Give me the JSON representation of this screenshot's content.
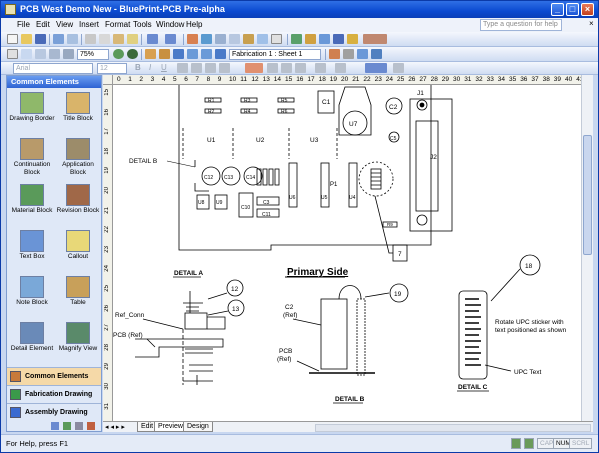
{
  "window": {
    "title": "PCB West Demo New - BluePrint-PCB Pre-alpha",
    "help_placeholder": "Type a question for help",
    "controls": {
      "minimize": "_",
      "maximize": "□",
      "close": "×"
    }
  },
  "menu": [
    "File",
    "Edit",
    "View",
    "Insert",
    "Format",
    "Tools",
    "Window",
    "Help"
  ],
  "toolbar2": {
    "zoom": "75%",
    "sheet": "Fabrication 1 : Sheet 1"
  },
  "toolbar3": {
    "font": "Arial",
    "size": "12",
    "bold": "B",
    "italic": "I",
    "underline": "U"
  },
  "panel": {
    "title": "Common Elements",
    "tiles": [
      {
        "label": "Drawing Border",
        "icon": "drawing-border-icon",
        "color": "#8fb86a"
      },
      {
        "label": "Title Block",
        "icon": "title-block-icon",
        "color": "#d9b46a"
      },
      {
        "label": "Continuation Block",
        "icon": "continuation-block-icon",
        "color": "#b89a6a"
      },
      {
        "label": "Application Block",
        "icon": "application-block-icon",
        "color": "#9c8c6a"
      },
      {
        "label": "Material Block",
        "icon": "material-block-icon",
        "color": "#5a9a5a"
      },
      {
        "label": "Revision Block",
        "icon": "revision-block-icon",
        "color": "#a06848"
      },
      {
        "label": "Text Box",
        "icon": "text-box-icon",
        "color": "#6a94d6"
      },
      {
        "label": "Callout",
        "icon": "callout-icon",
        "color": "#e8d878"
      },
      {
        "label": "Note Block",
        "icon": "note-block-icon",
        "color": "#7aa8d8"
      },
      {
        "label": "Table",
        "icon": "table-icon",
        "color": "#c8a05a"
      },
      {
        "label": "Detail Element",
        "icon": "detail-element-icon",
        "color": "#6a8ab8"
      },
      {
        "label": "Magnify View",
        "icon": "magnify-view-icon",
        "color": "#5a8a6a"
      }
    ],
    "categories": [
      {
        "label": "Common Elements",
        "icon": "common-elements-icon"
      },
      {
        "label": "Fabrication Drawing",
        "icon": "fabrication-drawing-icon"
      },
      {
        "label": "Assembly Drawing",
        "icon": "assembly-drawing-icon"
      }
    ]
  },
  "ruler": {
    "h": [
      "0",
      "1",
      "2",
      "3",
      "4",
      "5",
      "6",
      "7",
      "8",
      "9",
      "10",
      "11",
      "12",
      "13",
      "14",
      "15",
      "16",
      "17",
      "18",
      "19",
      "20",
      "21",
      "22",
      "23",
      "24",
      "25",
      "26",
      "27",
      "28",
      "29",
      "30",
      "31",
      "32",
      "33",
      "34",
      "35",
      "36",
      "37",
      "38",
      "39",
      "40",
      "41"
    ],
    "v": [
      "15",
      "16",
      "17",
      "18",
      "19",
      "20",
      "21",
      "22",
      "23",
      "24",
      "25",
      "26",
      "27",
      "28",
      "29",
      "30",
      "31"
    ]
  },
  "drawing": {
    "components": {
      "r1": "R1",
      "r2": "R2",
      "r3": "R3",
      "r4": "R4",
      "r5": "R5",
      "r6": "R6",
      "c1": "C1",
      "c2": "C2",
      "c5": "C5",
      "c3": "C3",
      "c11": "C11",
      "c10": "C10",
      "c12": "C12",
      "c13": "C13",
      "c14": "C14",
      "u1": "U1",
      "u2": "U2",
      "u3": "U3",
      "u7": "U7",
      "u6": "U6",
      "u5": "U5",
      "u4": "U4",
      "u8": "U8",
      "u9": "U9",
      "j1": "J1",
      "j2": "J2",
      "p1": "P1",
      "r9": "R9"
    },
    "detail_b_callout": "DETAIL B",
    "balloon_7": "7",
    "detail_a_title": "DETAIL A",
    "primary_side": "Primary Side",
    "balloon_12": "12",
    "balloon_13": "13",
    "ref_conn": "Ref_Conn",
    "pcb_ref_a": "PCB (Ref)",
    "c2_ref": "C2",
    "c2_ref2": "(Ref)",
    "balloon_19": "19",
    "pcb_ref_b1": "PCB",
    "pcb_ref_b2": "(Ref)",
    "detail_b_title": "DETAIL B",
    "balloon_18": "18",
    "upc_note_1": "Rotate UPC sticker with",
    "upc_note_2": "text positioned as shown",
    "upc_text": "UPC Text",
    "detail_c_title": "DETAIL C"
  },
  "tabs": {
    "nav": "◂ ◂ ▸ ▸",
    "items": [
      "Edit",
      "Preview",
      "Design"
    ],
    "active": "Preview"
  },
  "status": {
    "text": "For Help, press F1",
    "indicators": [
      "CAP",
      "NUM",
      "SCRL"
    ]
  }
}
